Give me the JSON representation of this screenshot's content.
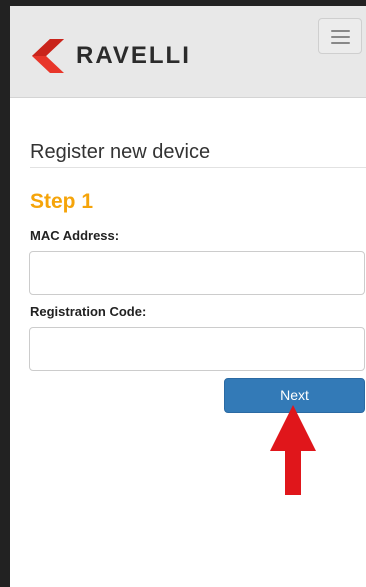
{
  "header": {
    "logo_text": "RAVELLI",
    "brand_color": "#e8362a",
    "logo_icon": "ravelli-flame-logo",
    "menu_icon": "hamburger-menu-icon"
  },
  "page": {
    "title": "Register new device"
  },
  "form": {
    "step_title": "Step 1",
    "step_color": "#f5a40a",
    "mac_label": "MAC Address:",
    "mac_value": "",
    "code_label": "Registration Code:",
    "code_value": "",
    "next_label": "Next",
    "button_color": "#337ab7"
  },
  "annotation": {
    "arrow_icon": "red-arrow-up-icon",
    "arrow_color": "#e0161b"
  }
}
